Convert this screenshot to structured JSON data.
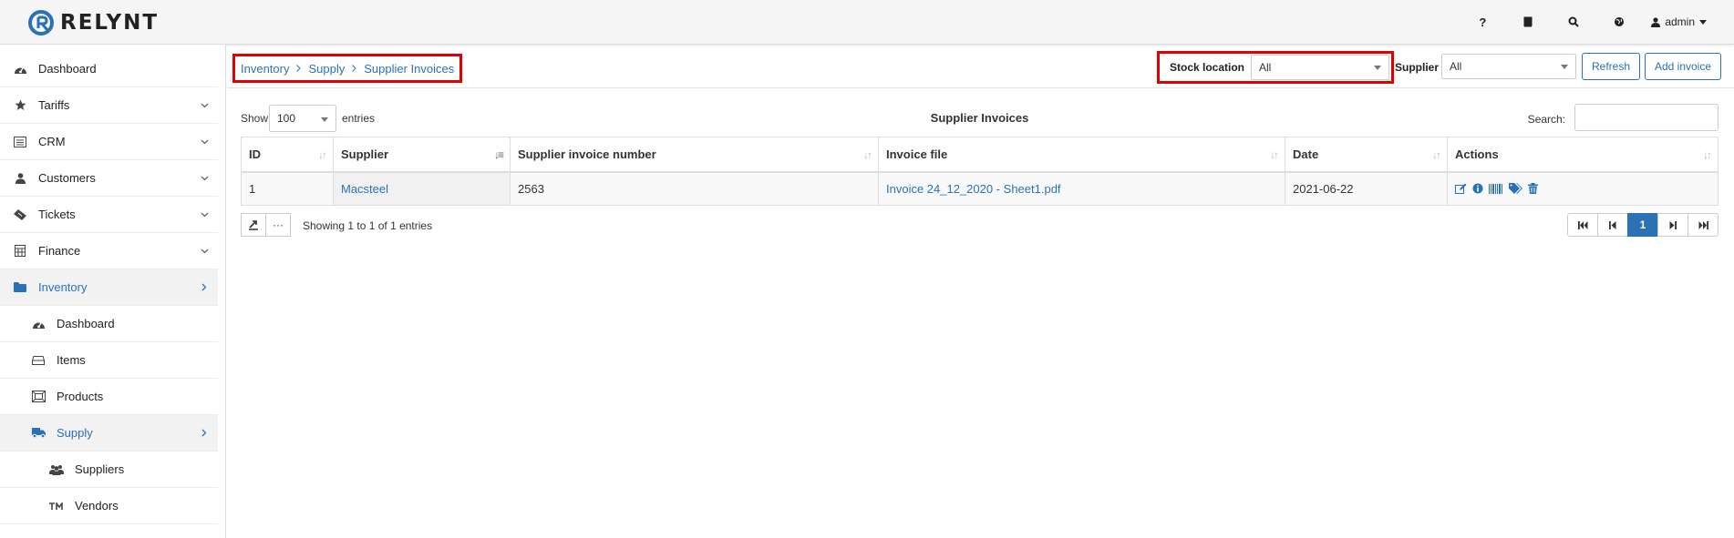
{
  "app": {
    "logo_text": "RELYNT"
  },
  "topbar": {
    "help_label": "?",
    "user_label": "admin",
    "icons": [
      "help-icon",
      "book-icon",
      "search-icon",
      "globe-icon",
      "user-icon"
    ]
  },
  "sidebar": {
    "items": [
      {
        "label": "Dashboard",
        "icon": "dashboard-icon"
      },
      {
        "label": "Tariffs",
        "icon": "star-icon"
      },
      {
        "label": "CRM",
        "icon": "crm-icon"
      },
      {
        "label": "Customers",
        "icon": "user-icon"
      },
      {
        "label": "Tickets",
        "icon": "ticket-icon"
      },
      {
        "label": "Finance",
        "icon": "calculator-icon"
      },
      {
        "label": "Inventory",
        "icon": "folder-icon"
      },
      {
        "label": "Dashboard",
        "icon": "dashboard-icon"
      },
      {
        "label": "Items",
        "icon": "inbox-icon"
      },
      {
        "label": "Products",
        "icon": "products-icon"
      },
      {
        "label": "Supply",
        "icon": "truck-icon"
      },
      {
        "label": "Suppliers",
        "icon": "users-icon"
      },
      {
        "label": "Vendors",
        "icon": "trademark-icon"
      }
    ]
  },
  "breadcrumb": [
    "Inventory",
    "Supply",
    "Supplier Invoices"
  ],
  "filters": {
    "stock_location_label": "Stock location",
    "stock_location_value": "All",
    "supplier_label": "Supplier",
    "supplier_value": "All"
  },
  "actions": {
    "refresh": "Refresh",
    "add_invoice": "Add invoice"
  },
  "table": {
    "show_label": "Show",
    "page_size": "100",
    "entries_label": "entries",
    "title": "Supplier Invoices",
    "search_label": "Search:",
    "search_value": "",
    "columns": [
      "ID",
      "Supplier",
      "Supplier invoice number",
      "Invoice file",
      "Date",
      "Actions"
    ],
    "rows": [
      {
        "id": "1",
        "supplier": "Macsteel",
        "invoice_number": "2563",
        "invoice_file": "Invoice 24_12_2020 - Sheet1.pdf",
        "date": "2021-06-22"
      }
    ],
    "row_actions": [
      "edit-icon",
      "info-icon",
      "barcode-icon",
      "tags-icon",
      "trash-icon"
    ],
    "footer": {
      "showing": "Showing 1 to 1 of 1 entries",
      "more_label": "···",
      "current_page": "1"
    }
  },
  "colors": {
    "accent": "#2a72b5",
    "highlight": "#e00000"
  }
}
